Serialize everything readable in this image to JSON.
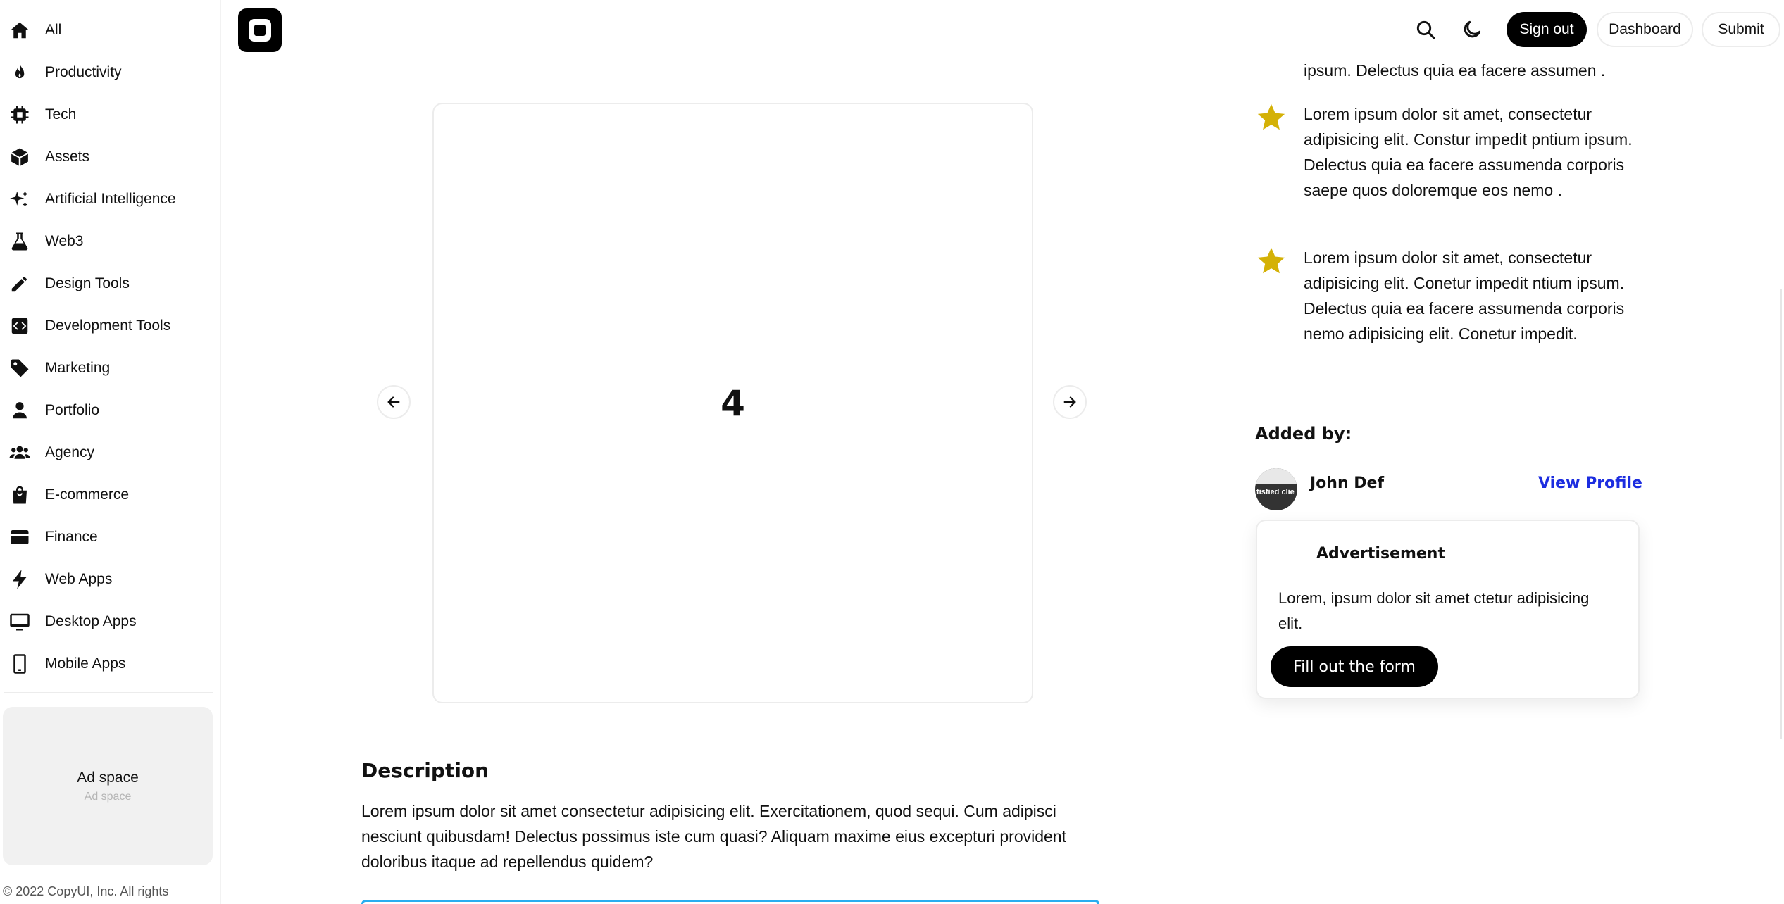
{
  "sidebar": {
    "items": [
      {
        "label": "All",
        "icon": "home-icon"
      },
      {
        "label": "Productivity",
        "icon": "fire-icon"
      },
      {
        "label": "Tech",
        "icon": "chip-icon"
      },
      {
        "label": "Assets",
        "icon": "cube-icon"
      },
      {
        "label": "Artificial Intelligence",
        "icon": "sparkles-icon"
      },
      {
        "label": "Web3",
        "icon": "flask-icon"
      },
      {
        "label": "Design Tools",
        "icon": "pencil-icon"
      },
      {
        "label": "Development Tools",
        "icon": "code-icon"
      },
      {
        "label": "Marketing",
        "icon": "tag-icon"
      },
      {
        "label": "Portfolio",
        "icon": "user-icon"
      },
      {
        "label": "Agency",
        "icon": "users-icon"
      },
      {
        "label": "E-commerce",
        "icon": "shopping-bag-icon"
      },
      {
        "label": "Finance",
        "icon": "credit-card-icon"
      },
      {
        "label": "Web Apps",
        "icon": "bolt-icon"
      },
      {
        "label": "Desktop Apps",
        "icon": "desktop-icon"
      },
      {
        "label": "Mobile Apps",
        "icon": "mobile-icon"
      }
    ],
    "ad": {
      "title": "Ad space",
      "subtitle": "Ad space"
    },
    "copyright": "© 2022 CopyUI, Inc. All rights"
  },
  "header": {
    "sign_out": "Sign out",
    "dashboard": "Dashboard",
    "submit": "Submit"
  },
  "carousel": {
    "slide_number": "4"
  },
  "description": {
    "title": "Description",
    "text": "Lorem ipsum dolor sit amet consectetur adipisicing elit. Exercitationem, quod sequi. Cum adipisci nesciunt quibusdam! Delectus possimus iste cum quasi? Aliquam maxime eius excepturi provident doloribus itaque ad repellendus quidem?"
  },
  "reviews": {
    "partial": "ipsum. Delectus quia ea facere assumen .",
    "items": [
      {
        "text": "Lorem ipsum dolor sit amet, consectetur adipisicing elit. Constur impedit pntium ipsum. Delectus quia ea facere assumenda corporis saepe quos doloremque eos nemo ."
      },
      {
        "text": "Lorem ipsum dolor sit amet, consectetur adipisicing elit. Conetur impedit ntium ipsum. Delectus quia ea facere assumenda corporis nemo adipisicing elit. Conetur impedit."
      }
    ]
  },
  "added_by": {
    "heading": "Added by:",
    "name": "John Def",
    "view_profile": "View Profile",
    "avatar_text": "tisfied clie"
  },
  "advertisement": {
    "title": "Advertisement",
    "text": "Lorem, ipsum dolor sit amet ctetur adipisicing elit.",
    "button": "Fill out the form"
  },
  "colors": {
    "star": "#d4b106",
    "link": "#1c2de0",
    "accent_border": "#29aef0"
  }
}
